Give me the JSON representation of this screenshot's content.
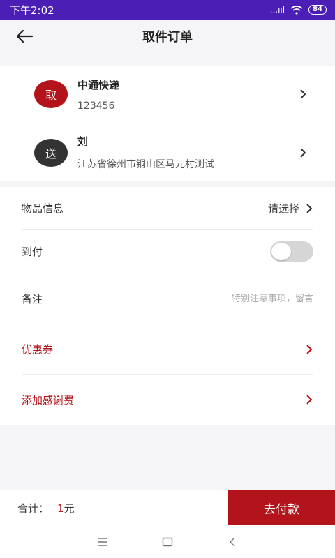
{
  "status_bar": {
    "time": "下午2:02",
    "signal": "...ııl",
    "battery": "84"
  },
  "header": {
    "title": "取件订单"
  },
  "pickup": {
    "badge": "取",
    "name": "中通快递",
    "sub": "123456"
  },
  "delivery": {
    "badge": "送",
    "name": "刘",
    "address": "江苏省徐州市铜山区马元村测试"
  },
  "form": {
    "item_label": "物品信息",
    "item_value": "请选择",
    "cod_label": "到付",
    "cod_on": false,
    "remark_label": "备注",
    "remark_placeholder": "特别注意事项，留言",
    "coupon_label": "优惠券",
    "tip_label": "添加感谢费"
  },
  "footer": {
    "total_label": "合计：",
    "amount": "1",
    "unit": "元",
    "pay_button": "去付款"
  },
  "colors": {
    "accent": "#b3141b",
    "status_bar": "#4b1fb5"
  }
}
